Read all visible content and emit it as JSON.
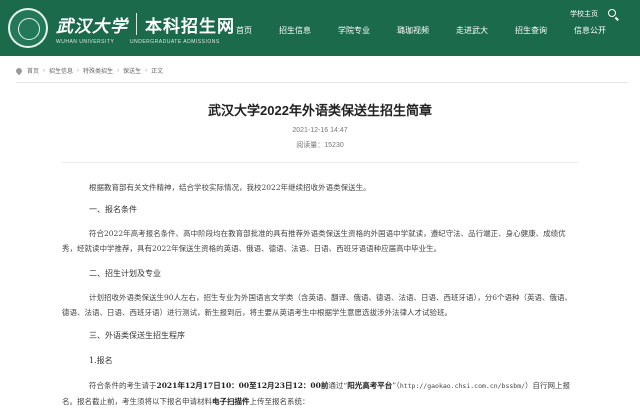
{
  "header": {
    "university_name": "武汉大学",
    "university_name_en": "WUHAN UNIVERSITY",
    "site_name": "本科招生网",
    "site_name_en": "UNDERGRADUATE ADMISSIONS",
    "school_home": "学校主页",
    "nav": [
      "首页",
      "招生信息",
      "学院专业",
      "璐珈视频",
      "走进武大",
      "招生查询",
      "信息公开"
    ],
    "color": "#1b6a4c"
  },
  "breadcrumb": [
    "首页",
    "招生信息",
    "特殊类招生",
    "保送生",
    "正文"
  ],
  "article": {
    "title": "武汉大学2022年外语类保送生招生简章",
    "date": "2021-12-16 14:47",
    "views_label": "阅读量：",
    "views": "15230",
    "intro": "根据教育部有关文件精神，结合学校实际情况，我校2022年继续招收外语类保送生。",
    "s1_title": "一、报名条件",
    "s1_text": "符合2022年高考报名条件、高中阶段均在教育部批准的具有推荐外语类保送生资格的外国语中学就读，遵纪守法、品行端正、身心健康、成绩优秀，经就读中学推荐，具有2022年保送生资格的英语、俄语、德语、法语、日语、西班牙语语种应届高中毕业生。",
    "s2_title": "二、招生计划及专业",
    "s2_text": "计划招收外语类保送生90人左右，招生专业为外国语言文学类（含英语、翻译、俄语、德语、法语、日语、西班牙语），分6个语种（英语、俄语、德语、法语、日语、西班牙语）进行测试，新生报到后，将主要从英语考生中根据学生意愿选拔涉外法律人才试验班。",
    "s3_title": "三、外语类保送生招生程序",
    "s3_sub": "1.报名",
    "s3_text_a": "符合条件的考生请于",
    "s3_text_b": "2021年12月17日10：00至12月23日12：00前",
    "s3_text_c": "通过“",
    "s3_text_d": "阳光高考平台",
    "s3_text_e": "”（",
    "s3_text_url": "http://gaokao.chsi.com.cn/bssbm/",
    "s3_text_f": "）自行网上报名。报名截止前，考生须将以下报名申请材料",
    "s3_text_g": "电子扫描件",
    "s3_text_h": "上传至报名系统："
  }
}
